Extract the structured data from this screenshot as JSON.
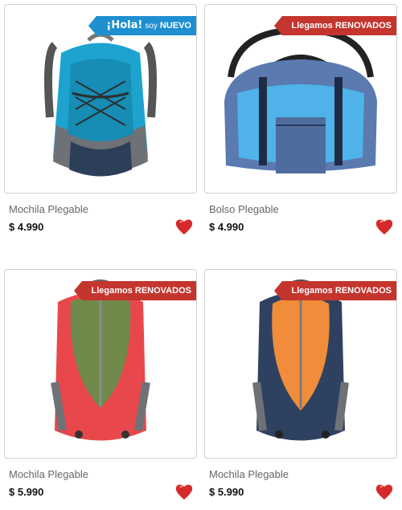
{
  "colors": {
    "ribbon_new": "#1f8fd0",
    "ribbon_renewed": "#c4352e",
    "heart": "#d62a2a"
  },
  "products": [
    {
      "title": "Mochila Plegable",
      "price": "$ 4.990",
      "badge": {
        "part1": "¡Hola!",
        "part2": "soy",
        "part3": "NUEVO"
      },
      "favorite_icon": "heart-icon"
    },
    {
      "title": "Bolso Plegable",
      "price": "$ 4.990",
      "badge": {
        "text": "Llegamos RENOVADOS"
      },
      "favorite_icon": "heart-icon"
    },
    {
      "title": "Mochila Plegable",
      "price": "$ 5.990",
      "badge": {
        "text": "Llegamos RENOVADOS"
      },
      "favorite_icon": "heart-icon"
    },
    {
      "title": "Mochila Plegable",
      "price": "$ 5.990",
      "badge": {
        "text": "Llegamos RENOVADOS"
      },
      "favorite_icon": "heart-icon"
    }
  ]
}
